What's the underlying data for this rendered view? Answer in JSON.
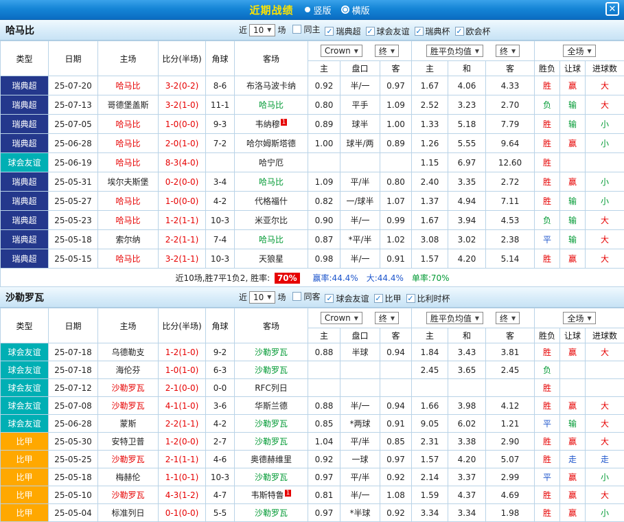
{
  "titlebar": {
    "title": "近期战绩",
    "view_options": [
      {
        "label": "竖版",
        "selected": false
      },
      {
        "label": "横版",
        "selected": true
      }
    ],
    "close_icon": "✕"
  },
  "controls": {
    "near": "近",
    "count": "10",
    "games": "场",
    "dropdown_arrow": "▼"
  },
  "table": {
    "columns": {
      "type": "类型",
      "date": "日期",
      "home": "主场",
      "score": "比分(半场)",
      "corner": "角球",
      "away": "客场",
      "odds_sub": [
        "主",
        "盘口",
        "客"
      ],
      "avg_sub": [
        "主",
        "和",
        "客"
      ],
      "result_sub": [
        "胜负",
        "让球",
        "进球数"
      ]
    },
    "dropdowns": {
      "odds_source": "Crown",
      "final": "终",
      "avg_label": "胜平负均值",
      "scope": "全场"
    }
  },
  "colors": {
    "win": "#e60000",
    "lose": "#009933",
    "draw": "#1e56cc",
    "score": "#e60000",
    "badge_bg": "#e60000",
    "league": {
      "瑞典超": "#24388c",
      "球会友谊": "#00afb4",
      "比甲": "#ffa800"
    }
  },
  "sections": [
    {
      "team": "哈马比",
      "filters": [
        {
          "label": "同主",
          "checked": false
        },
        {
          "label": "瑞典超",
          "checked": true
        },
        {
          "label": "球会友谊",
          "checked": true
        },
        {
          "label": "瑞典杯",
          "checked": true
        },
        {
          "label": "欧会杯",
          "checked": true
        }
      ],
      "rows": [
        {
          "league": "瑞典超",
          "date": "25-07-20",
          "home": "哈马比",
          "score": "3-2(0-2)",
          "corner": "8-6",
          "away": "布洛马波卡纳",
          "odds": [
            "0.92",
            "半/一",
            "0.97"
          ],
          "avg": [
            "1.67",
            "4.06",
            "4.33"
          ],
          "res": [
            "胜",
            "赢",
            "大"
          ]
        },
        {
          "league": "瑞典超",
          "date": "25-07-13",
          "home": "哥德堡盖斯",
          "score": "3-2(1-0)",
          "corner": "11-1",
          "away": "哈马比",
          "odds": [
            "0.80",
            "平手",
            "1.09"
          ],
          "avg": [
            "2.52",
            "3.23",
            "2.70"
          ],
          "res": [
            "负",
            "输",
            "大"
          ]
        },
        {
          "league": "瑞典超",
          "date": "25-07-05",
          "home": "哈马比",
          "score": "1-0(0-0)",
          "corner": "9-3",
          "away": "韦纳穆",
          "away_sup": "1",
          "odds": [
            "0.89",
            "球半",
            "1.00"
          ],
          "avg": [
            "1.33",
            "5.18",
            "7.79"
          ],
          "res": [
            "胜",
            "输",
            "小"
          ]
        },
        {
          "league": "瑞典超",
          "date": "25-06-28",
          "home": "哈马比",
          "score": "2-0(1-0)",
          "corner": "7-2",
          "away": "哈尔姆斯塔德",
          "odds": [
            "1.00",
            "球半/两",
            "0.89"
          ],
          "avg": [
            "1.26",
            "5.55",
            "9.64"
          ],
          "res": [
            "胜",
            "赢",
            "小"
          ]
        },
        {
          "league": "球会友谊",
          "date": "25-06-19",
          "home": "哈马比",
          "score": "8-3(4-0)",
          "corner": "",
          "away": "哈宁厄",
          "odds": [
            "",
            "",
            ""
          ],
          "avg": [
            "1.15",
            "6.97",
            "12.60"
          ],
          "res": [
            "胜",
            "",
            ""
          ]
        },
        {
          "league": "瑞典超",
          "date": "25-05-31",
          "home": "埃尔夫斯堡",
          "score": "0-2(0-0)",
          "corner": "3-4",
          "away": "哈马比",
          "odds": [
            "1.09",
            "平/半",
            "0.80"
          ],
          "avg": [
            "2.40",
            "3.35",
            "2.72"
          ],
          "res": [
            "胜",
            "赢",
            "小"
          ]
        },
        {
          "league": "瑞典超",
          "date": "25-05-27",
          "home": "哈马比",
          "score": "1-0(0-0)",
          "corner": "4-2",
          "away": "代格福什",
          "odds": [
            "0.82",
            "一/球半",
            "1.07"
          ],
          "avg": [
            "1.37",
            "4.94",
            "7.11"
          ],
          "res": [
            "胜",
            "输",
            "小"
          ]
        },
        {
          "league": "瑞典超",
          "date": "25-05-23",
          "home": "哈马比",
          "score": "1-2(1-1)",
          "corner": "10-3",
          "away": "米亚尔比",
          "odds": [
            "0.90",
            "半/一",
            "0.99"
          ],
          "avg": [
            "1.67",
            "3.94",
            "4.53"
          ],
          "res": [
            "负",
            "输",
            "大"
          ]
        },
        {
          "league": "瑞典超",
          "date": "25-05-18",
          "home": "索尔纳",
          "score": "2-2(1-1)",
          "corner": "7-4",
          "away": "哈马比",
          "odds": [
            "0.87",
            "*平/半",
            "1.02"
          ],
          "avg": [
            "3.08",
            "3.02",
            "2.38"
          ],
          "res": [
            "平",
            "输",
            "大"
          ]
        },
        {
          "league": "瑞典超",
          "date": "25-05-15",
          "home": "哈马比",
          "score": "3-2(1-1)",
          "corner": "10-3",
          "away": "天狼星",
          "odds": [
            "0.98",
            "半/一",
            "0.91"
          ],
          "avg": [
            "1.57",
            "4.20",
            "5.14"
          ],
          "res": [
            "胜",
            "赢",
            "大"
          ]
        }
      ],
      "summary": {
        "prefix": "近10场,胜7平1负2, 胜率:",
        "badge": "70%",
        "stats": [
          {
            "text": "赢率:44.4%",
            "color": "#1e56cc"
          },
          {
            "text": "大:44.4%",
            "color": "#1e56cc"
          },
          {
            "text": "单率:70%",
            "color": "#009933"
          }
        ]
      }
    },
    {
      "team": "沙勒罗瓦",
      "filters": [
        {
          "label": "同客",
          "checked": false
        },
        {
          "label": "球会友谊",
          "checked": true
        },
        {
          "label": "比甲",
          "checked": true
        },
        {
          "label": "比利时杯",
          "checked": true
        }
      ],
      "rows": [
        {
          "league": "球会友谊",
          "date": "25-07-18",
          "home": "乌德勒支",
          "score": "1-2(1-0)",
          "corner": "9-2",
          "away": "沙勒罗瓦",
          "odds": [
            "0.88",
            "半球",
            "0.94"
          ],
          "avg": [
            "1.84",
            "3.43",
            "3.81"
          ],
          "res": [
            "胜",
            "赢",
            "大"
          ]
        },
        {
          "league": "球会友谊",
          "date": "25-07-18",
          "home": "海伦芬",
          "score": "1-0(1-0)",
          "corner": "6-3",
          "away": "沙勒罗瓦",
          "odds": [
            "",
            "",
            ""
          ],
          "avg": [
            "2.45",
            "3.65",
            "2.45"
          ],
          "res": [
            "负",
            "",
            ""
          ]
        },
        {
          "league": "球会友谊",
          "date": "25-07-12",
          "home": "沙勒罗瓦",
          "score": "2-1(0-0)",
          "corner": "0-0",
          "away": "RFC列日",
          "odds": [
            "",
            "",
            ""
          ],
          "avg": [
            "",
            "",
            ""
          ],
          "res": [
            "胜",
            "",
            ""
          ]
        },
        {
          "league": "球会友谊",
          "date": "25-07-08",
          "home": "沙勒罗瓦",
          "score": "4-1(1-0)",
          "corner": "3-6",
          "away": "华斯兰德",
          "odds": [
            "0.88",
            "半/一",
            "0.94"
          ],
          "avg": [
            "1.66",
            "3.98",
            "4.12"
          ],
          "res": [
            "胜",
            "赢",
            "大"
          ]
        },
        {
          "league": "球会友谊",
          "date": "25-06-28",
          "home": "蒙斯",
          "score": "2-2(1-1)",
          "corner": "4-2",
          "away": "沙勒罗瓦",
          "odds": [
            "0.85",
            "*两球",
            "0.91"
          ],
          "avg": [
            "9.05",
            "6.02",
            "1.21"
          ],
          "res": [
            "平",
            "输",
            "大"
          ]
        },
        {
          "league": "比甲",
          "date": "25-05-30",
          "home": "安特卫普",
          "score": "1-2(0-0)",
          "corner": "2-7",
          "away": "沙勒罗瓦",
          "odds": [
            "1.04",
            "平/半",
            "0.85"
          ],
          "avg": [
            "2.31",
            "3.38",
            "2.90"
          ],
          "res": [
            "胜",
            "赢",
            "大"
          ]
        },
        {
          "league": "比甲",
          "date": "25-05-25",
          "home": "沙勒罗瓦",
          "score": "2-1(1-1)",
          "corner": "4-6",
          "away": "奥德赫维里",
          "odds": [
            "0.92",
            "一球",
            "0.97"
          ],
          "avg": [
            "1.57",
            "4.20",
            "5.07"
          ],
          "res": [
            "胜",
            "走",
            "走"
          ]
        },
        {
          "league": "比甲",
          "date": "25-05-18",
          "home": "梅赫伦",
          "score": "1-1(0-1)",
          "corner": "10-3",
          "away": "沙勒罗瓦",
          "odds": [
            "0.97",
            "平/半",
            "0.92"
          ],
          "avg": [
            "2.14",
            "3.37",
            "2.99"
          ],
          "res": [
            "平",
            "赢",
            "小"
          ]
        },
        {
          "league": "比甲",
          "date": "25-05-10",
          "home": "沙勒罗瓦",
          "score": "4-3(1-2)",
          "corner": "4-7",
          "away": "韦斯特鲁",
          "away_sup": "1",
          "odds": [
            "0.81",
            "半/一",
            "1.08"
          ],
          "avg": [
            "1.59",
            "4.37",
            "4.69"
          ],
          "res": [
            "胜",
            "赢",
            "大"
          ]
        },
        {
          "league": "比甲",
          "date": "25-05-04",
          "home": "标准列日",
          "score": "0-1(0-0)",
          "corner": "5-5",
          "away": "沙勒罗瓦",
          "odds": [
            "0.97",
            "*半球",
            "0.92"
          ],
          "avg": [
            "3.34",
            "3.34",
            "1.98"
          ],
          "res": [
            "胜",
            "赢",
            "小"
          ]
        }
      ]
    }
  ]
}
